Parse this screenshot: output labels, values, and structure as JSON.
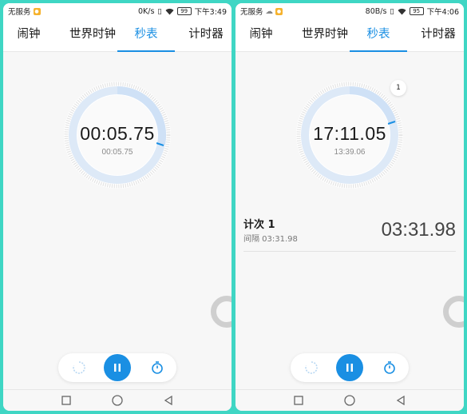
{
  "colors": {
    "accent": "#1a8fe3",
    "background_frame": "#3fd6c4"
  },
  "screens": [
    {
      "status": {
        "carrier": "无服务",
        "net_speed": "0K/s",
        "battery": "99",
        "time": "下午3:49"
      },
      "tabs": [
        {
          "label": "闹钟",
          "active": false
        },
        {
          "label": "世界时钟",
          "active": false
        },
        {
          "label": "秒表",
          "active": true
        },
        {
          "label": "计时器",
          "active": false
        }
      ],
      "stopwatch": {
        "main_time": "00:05.75",
        "sub_time": "00:05.75",
        "lap_count": null
      },
      "laps": [],
      "controls": {
        "reset_icon": "reset-icon",
        "pause_icon": "pause-icon",
        "lap_icon": "stopwatch-icon"
      },
      "nav": [
        "square-icon",
        "circle-icon",
        "triangle-back-icon"
      ]
    },
    {
      "status": {
        "carrier": "无服务",
        "net_speed": "80B/s",
        "battery": "95",
        "time": "下午4:06"
      },
      "tabs": [
        {
          "label": "闹钟",
          "active": false
        },
        {
          "label": "世界时钟",
          "active": false
        },
        {
          "label": "秒表",
          "active": true
        },
        {
          "label": "计时器",
          "active": false
        }
      ],
      "stopwatch": {
        "main_time": "17:11.05",
        "sub_time": "13:39.06",
        "lap_count": "1"
      },
      "laps": [
        {
          "title": "计次 1",
          "interval": "间隔 03:31.98",
          "time": "03:31.98"
        }
      ],
      "controls": {
        "reset_icon": "reset-icon",
        "pause_icon": "pause-icon",
        "lap_icon": "stopwatch-icon"
      },
      "nav": [
        "square-icon",
        "circle-icon",
        "triangle-back-icon"
      ]
    }
  ]
}
